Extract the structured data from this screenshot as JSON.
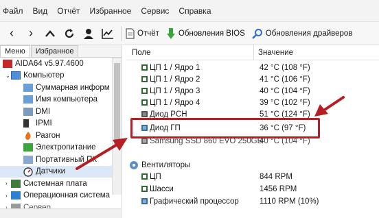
{
  "menu": [
    "Файл",
    "Вид",
    "Отчёт",
    "Избранное",
    "Сервис",
    "Справка"
  ],
  "toolbar": {
    "report_label": "Отчёт",
    "bios_label": "Обновления BIOS",
    "drivers_label": "Обновления драйверов"
  },
  "sidebar": {
    "tabs": [
      "Меню",
      "Избранное"
    ],
    "items": [
      {
        "label": "AIDA64 v5.97.4600"
      },
      {
        "label": "Компьютер"
      },
      {
        "label": "Суммарная информ"
      },
      {
        "label": "Имя компьютера"
      },
      {
        "label": "DMI"
      },
      {
        "label": "IPMI"
      },
      {
        "label": "Разгон"
      },
      {
        "label": "Электропитание"
      },
      {
        "label": "Портативный ПК"
      },
      {
        "label": "Датчики"
      },
      {
        "label": "Системная плата"
      },
      {
        "label": "Операционная система"
      },
      {
        "label": "Сервер"
      }
    ]
  },
  "table": {
    "col_field": "Поле",
    "col_value": "Значение",
    "temps": [
      {
        "name": "ЦП 1 / Ядро 1",
        "value": "42 °C  (108 °F)"
      },
      {
        "name": "ЦП 1 / Ядро 2",
        "value": "41 °C  (106 °F)"
      },
      {
        "name": "ЦП 1 / Ядро 3",
        "value": "40 °C  (104 °F)"
      },
      {
        "name": "ЦП 1 / Ядро 4",
        "value": "39 °C  (102 °F)"
      },
      {
        "name": "Диод PCH",
        "value": "51 °C  (124 °F)"
      },
      {
        "name": "Диод ГП",
        "value": "36 °C  (97 °F)"
      },
      {
        "name": "Samsung SSD 860 EVO 250GB",
        "value": "40 °C  (104 °F)"
      }
    ],
    "fans_group": "Вентиляторы",
    "fans": [
      {
        "name": "ЦП",
        "value": "844 RPM"
      },
      {
        "name": "Шасси",
        "value": "1456 RPM"
      },
      {
        "name": "Графический процессор",
        "value": "1110 RPM  (10%)"
      }
    ]
  },
  "colors": {
    "accent": "#b51e24",
    "selection": "#dbe8f8"
  }
}
